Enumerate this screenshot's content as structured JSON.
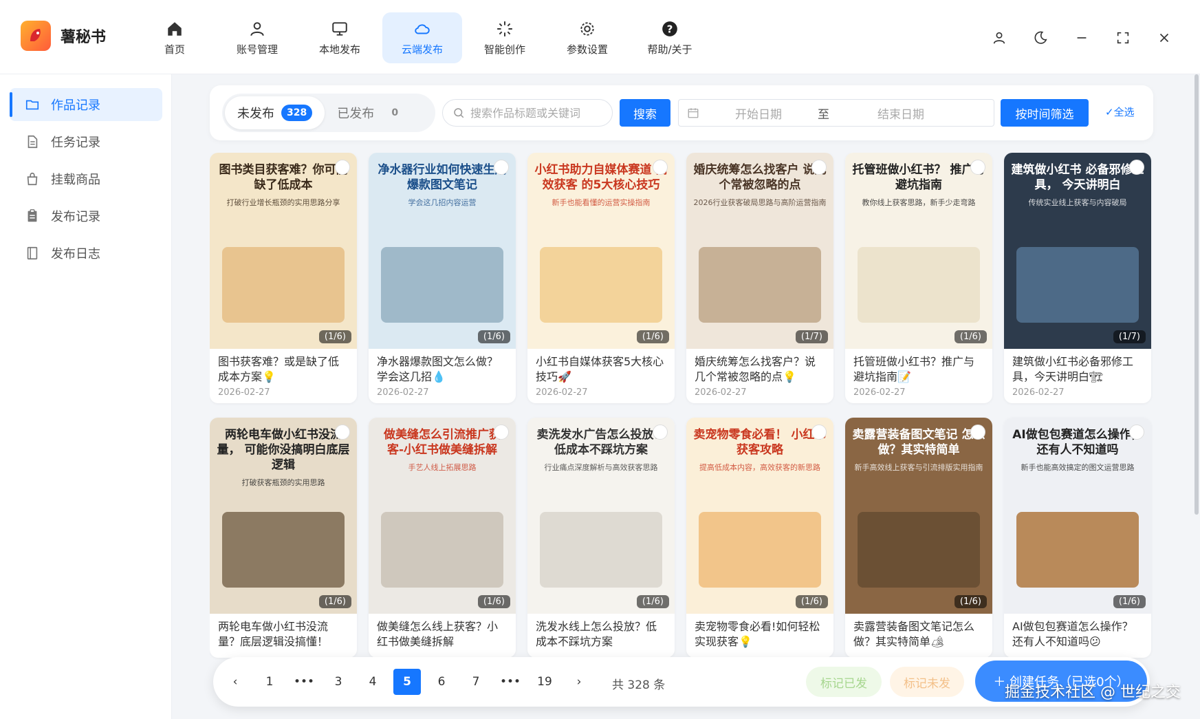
{
  "app": {
    "title": "薯秘书"
  },
  "nav": [
    {
      "label": "首页",
      "icon": "home-icon"
    },
    {
      "label": "账号管理",
      "icon": "user-icon"
    },
    {
      "label": "本地发布",
      "icon": "monitor-icon"
    },
    {
      "label": "云端发布",
      "icon": "cloud-icon",
      "active": true
    },
    {
      "label": "智能创作",
      "icon": "sparkle-icon"
    },
    {
      "label": "参数设置",
      "icon": "gear-icon"
    },
    {
      "label": "帮助/关于",
      "icon": "help-icon"
    }
  ],
  "sidebar": {
    "items": [
      {
        "label": "作品记录",
        "icon": "folder-icon",
        "active": true
      },
      {
        "label": "任务记录",
        "icon": "document-icon"
      },
      {
        "label": "挂载商品",
        "icon": "bag-icon"
      },
      {
        "label": "发布记录",
        "icon": "clipboard-icon"
      },
      {
        "label": "发布日志",
        "icon": "book-icon"
      }
    ]
  },
  "filters": {
    "tab_unpublished": "未发布",
    "count_unpublished": "328",
    "tab_published": "已发布",
    "count_published": "0",
    "search_placeholder": "搜索作品标题或关键词",
    "search_button": "搜索",
    "start_date_placeholder": "开始日期",
    "date_separator": "至",
    "end_date_placeholder": "结束日期",
    "time_filter_button": "按时间筛选",
    "select_all": "✓全选"
  },
  "cards": [
    {
      "title": "图书获客难？或是缺了低成本方案💡",
      "date": "2026-02-27",
      "pages": "(1/6)",
      "head": "图书类目获客难？你可能缺了低成本",
      "sub": "打破行业增长瓶颈的实用思路分享",
      "bg": "#f4e6c9",
      "fg": "#3a2a1a",
      "art": "#e8c48f"
    },
    {
      "title": "净水器爆款图文怎么做？学会这几招💧",
      "date": "2026-02-27",
      "pages": "(1/6)",
      "head": "净水器行业如何快速生成爆款图文笔记",
      "sub": "学会这几招内容运营",
      "bg": "#dbe9f2",
      "fg": "#1b4f8a",
      "art": "#9fb9c9"
    },
    {
      "title": "小红书自媒体获客5大核心技巧🚀",
      "date": "2026-02-27",
      "pages": "(1/6)",
      "head": "小红书助力自媒体赛道 高效获客 的5大核心技巧",
      "sub": "新手也能看懂的运营实操指南",
      "bg": "#fbf1dc",
      "fg": "#c9371f",
      "art": "#f3d39a"
    },
    {
      "title": "婚庆统筹怎么找客户？说几个常被忽略的点💡",
      "date": "2026-02-27",
      "pages": "(1/7)",
      "head": "婚庆统筹怎么找客户 说几个常被忽略的点",
      "sub": "2026行业获客破局思路与高阶运营指南",
      "bg": "#efe6da",
      "fg": "#4a3526",
      "art": "#c7b196"
    },
    {
      "title": "托管班做小红书？推广与避坑指南📝",
      "date": "2026-02-27",
      "pages": "(1/6)",
      "head": "托管班做小红书？ 推广与避坑指南",
      "sub": "教你线上获客思路，新手少走弯路",
      "bg": "#f7f2e6",
      "fg": "#222222",
      "art": "#ece3cc"
    },
    {
      "title": "建筑做小红书必备邪修工具，今天讲明白🏗",
      "date": "2026-02-27",
      "pages": "(1/7)",
      "head": "建筑做小红书 必备邪修工具， 今天讲明白",
      "sub": "传统实业线上获客与内容破局",
      "bg": "#2d3b4c",
      "fg": "#ffffff",
      "art": "#4d6a87"
    },
    {
      "title": "两轮电车做小红书没流量？底层逻辑没搞懂！",
      "date": "",
      "pages": "(1/6)",
      "head": "两轮电车做小红书没流量， 可能你没搞明白底层逻辑",
      "sub": "打破获客瓶颈的实用思路",
      "bg": "#e7dcc9",
      "fg": "#222222",
      "art": "#8c7a62"
    },
    {
      "title": "做美缝怎么线上获客？小红书做美缝拆解",
      "date": "",
      "pages": "(1/6)",
      "head": "做美缝怎么引流推广获客-小红书做美缝拆解",
      "sub": "手艺人线上拓展思路",
      "bg": "#ece9e4",
      "fg": "#c9371f",
      "art": "#cfc8bd"
    },
    {
      "title": "洗发水线上怎么投放？低成本不踩坑方案",
      "date": "",
      "pages": "(1/6)",
      "head": "卖洗发水广告怎么投放？ 低成本不踩坑方案",
      "sub": "行业痛点深度解析与高效获客思路",
      "bg": "#f5f3ee",
      "fg": "#333333",
      "art": "#dedad2"
    },
    {
      "title": "卖宠物零食必看!如何轻松实现获客💡",
      "date": "",
      "pages": "(1/6)",
      "head": "卖宠物零食必看！ 小红书获客攻略",
      "sub": "提高低成本内容，高效获客的新思路",
      "bg": "#fbefd8",
      "fg": "#c9371f",
      "art": "#f2c58a"
    },
    {
      "title": "卖露营装备图文笔记怎么做？其实特简单🏕",
      "date": "",
      "pages": "(1/6)",
      "head": "卖露营装备图文笔记 怎么做？其实特简单",
      "sub": "新手高效线上获客与引流排版实用指南",
      "bg": "#8a6644",
      "fg": "#ffffff",
      "art": "#6b5034"
    },
    {
      "title": "AI做包包赛道怎么操作？还有人不知道吗😕",
      "date": "",
      "pages": "(1/6)",
      "head": "AI做包包赛道怎么操作， 还有人不知道吗",
      "sub": "新手也能高效搞定的图文运营思路",
      "bg": "#eef0f4",
      "fg": "#222222",
      "art": "#b98a5a"
    }
  ],
  "pager": {
    "pages": [
      "1",
      "•••",
      "3",
      "4",
      "5",
      "6",
      "7",
      "•••",
      "19"
    ],
    "current": "5",
    "prev": "‹",
    "next": "›",
    "total": "共 328 条",
    "mark_published": "标记已发",
    "mark_unpublished": "标记未发",
    "create_task": "＋ 创建任务（已选0个）"
  },
  "watermark": "掘金技术社区 @ 世纪之交",
  "colors": {
    "primary": "#1677ff",
    "active_bg": "#e4f0ff"
  }
}
